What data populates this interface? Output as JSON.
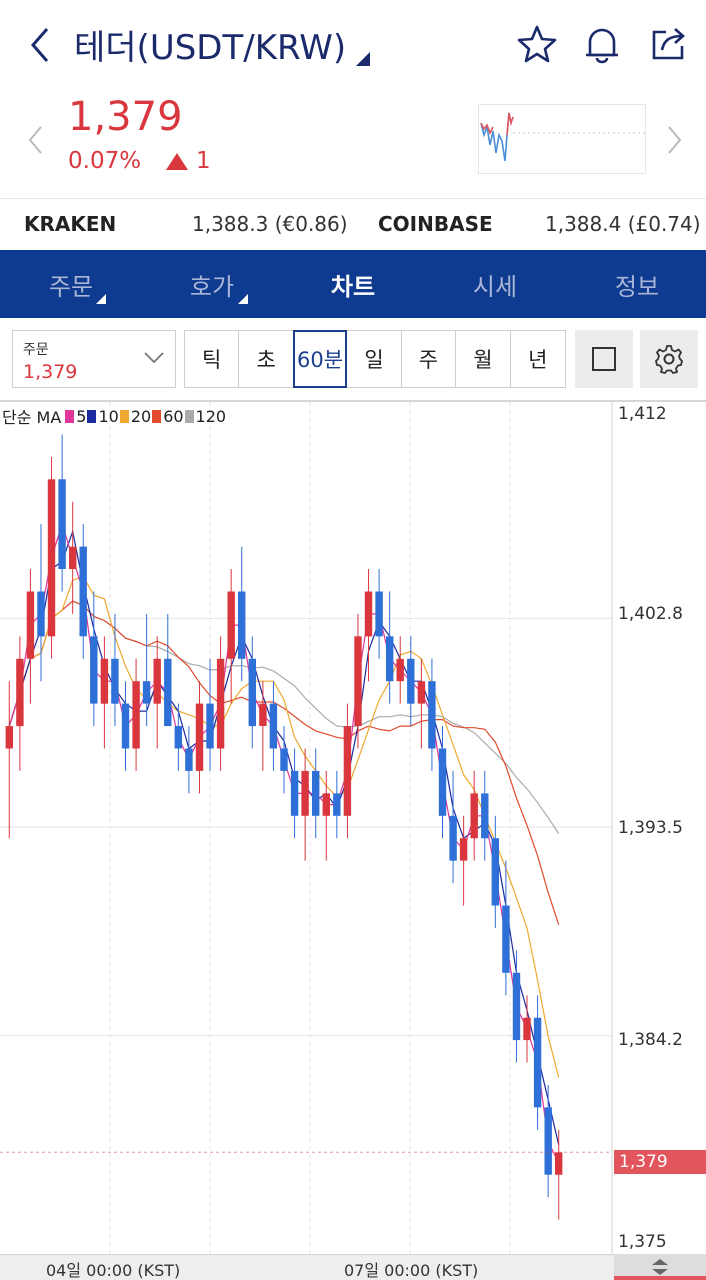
{
  "header": {
    "title": "테더(USDT/KRW)",
    "icons": [
      "back-chevron-icon",
      "star-icon",
      "bell-icon",
      "share-icon"
    ]
  },
  "summary": {
    "price": "1,379",
    "change_pct": "0.07%",
    "change_value": "1",
    "direction": "up",
    "color": "#d9363e"
  },
  "exchanges": [
    {
      "name": "KRAKEN",
      "value": "1,388.3 (€0.86)"
    },
    {
      "name": "COINBASE",
      "value": "1,388.4 (£0.74)"
    }
  ],
  "tabs": [
    {
      "label": "주문",
      "active": false,
      "has_menu": true
    },
    {
      "label": "호가",
      "active": false,
      "has_menu": true
    },
    {
      "label": "차트",
      "active": true,
      "has_menu": false
    },
    {
      "label": "시세",
      "active": false,
      "has_menu": false
    },
    {
      "label": "정보",
      "active": false,
      "has_menu": false
    }
  ],
  "toolbar": {
    "order_label": "주문",
    "order_value": "1,379",
    "periods": [
      "틱",
      "초",
      "60분",
      "일",
      "주",
      "월",
      "년"
    ],
    "active_period": "60분"
  },
  "chart_legend": {
    "prefix": "단순 MA",
    "items": [
      {
        "label": "5",
        "color": "#e0359a"
      },
      {
        "label": "10",
        "color": "#1b2aa0"
      },
      {
        "label": "20",
        "color": "#f0a830"
      },
      {
        "label": "60",
        "color": "#e24a2e"
      },
      {
        "label": "120",
        "color": "#aaaaaa"
      }
    ]
  },
  "chart_axes": {
    "y_ticks": [
      "1,412",
      "1,402.8",
      "1,393.5",
      "1,384.2",
      "1,375"
    ],
    "current_price_tag": "1,379",
    "x_ticks": [
      "04일 00:00 (KST)",
      "07일 00:00 (KST)"
    ]
  },
  "chart_data": {
    "type": "candlestick",
    "interval": "60분",
    "ylim": [
      1375,
      1412
    ],
    "up_color": "#d9363e",
    "down_color": "#2f6fd8",
    "candles": [
      [
        1397,
        1400,
        1393,
        1398
      ],
      [
        1398,
        1402,
        1396,
        1401
      ],
      [
        1401,
        1405,
        1399,
        1404
      ],
      [
        1404,
        1407,
        1400,
        1402
      ],
      [
        1402,
        1410,
        1401,
        1409
      ],
      [
        1409,
        1411,
        1404,
        1405
      ],
      [
        1405,
        1408,
        1403,
        1406
      ],
      [
        1406,
        1407,
        1401,
        1402
      ],
      [
        1402,
        1404,
        1398,
        1399
      ],
      [
        1399,
        1402,
        1397,
        1401
      ],
      [
        1401,
        1403,
        1398,
        1399
      ],
      [
        1399,
        1400,
        1396,
        1397
      ],
      [
        1397,
        1401,
        1396,
        1400
      ],
      [
        1400,
        1403,
        1398,
        1399
      ],
      [
        1399,
        1402,
        1397,
        1401
      ],
      [
        1401,
        1403,
        1398,
        1398
      ],
      [
        1398,
        1399,
        1396,
        1397
      ],
      [
        1397,
        1398,
        1395,
        1396
      ],
      [
        1396,
        1400,
        1395,
        1399
      ],
      [
        1399,
        1401,
        1396,
        1397
      ],
      [
        1397,
        1402,
        1396,
        1401
      ],
      [
        1401,
        1405,
        1399,
        1404
      ],
      [
        1404,
        1406,
        1400,
        1401
      ],
      [
        1401,
        1402,
        1397,
        1398
      ],
      [
        1398,
        1400,
        1396,
        1399
      ],
      [
        1399,
        1400,
        1396,
        1397
      ],
      [
        1397,
        1398,
        1395,
        1396
      ],
      [
        1396,
        1397,
        1393,
        1394
      ],
      [
        1394,
        1397,
        1392,
        1396
      ],
      [
        1396,
        1397,
        1393,
        1394
      ],
      [
        1394,
        1396,
        1392,
        1395
      ],
      [
        1395,
        1396,
        1393,
        1394
      ],
      [
        1394,
        1399,
        1393,
        1398
      ],
      [
        1398,
        1403,
        1397,
        1402
      ],
      [
        1402,
        1405,
        1400,
        1404
      ],
      [
        1404,
        1405,
        1401,
        1402
      ],
      [
        1402,
        1404,
        1399,
        1400
      ],
      [
        1400,
        1402,
        1399,
        1401
      ],
      [
        1401,
        1402,
        1398,
        1399
      ],
      [
        1399,
        1401,
        1397,
        1400
      ],
      [
        1400,
        1401,
        1396,
        1397
      ],
      [
        1397,
        1398,
        1393,
        1394
      ],
      [
        1394,
        1396,
        1391,
        1392
      ],
      [
        1392,
        1394,
        1390,
        1393
      ],
      [
        1393,
        1396,
        1392,
        1395
      ],
      [
        1395,
        1396,
        1392,
        1393
      ],
      [
        1393,
        1394,
        1389,
        1390
      ],
      [
        1390,
        1392,
        1386,
        1387
      ],
      [
        1387,
        1388,
        1383,
        1384
      ],
      [
        1384,
        1386,
        1383,
        1385
      ],
      [
        1385,
        1386,
        1380,
        1381
      ],
      [
        1381,
        1382,
        1377,
        1378
      ],
      [
        1378,
        1380,
        1376,
        1379
      ]
    ]
  }
}
